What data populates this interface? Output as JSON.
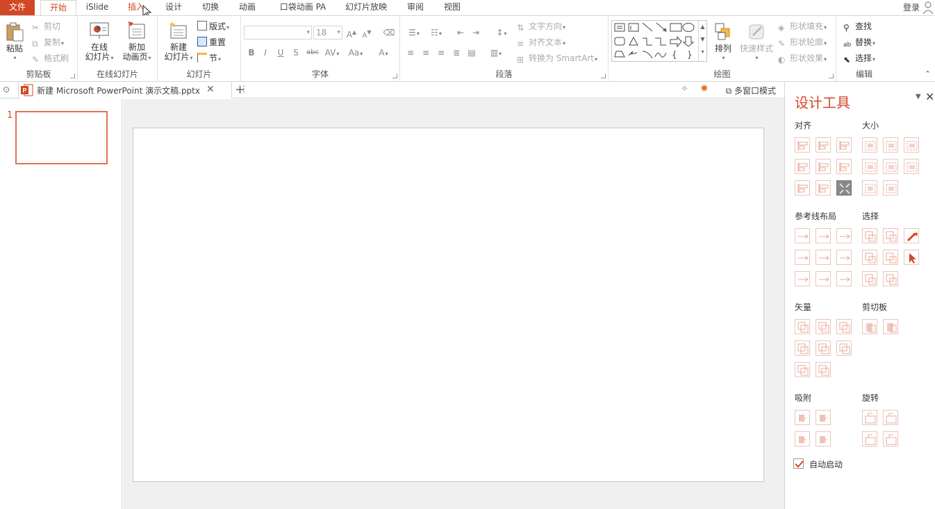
{
  "ribbon_tabs": {
    "file": "文件",
    "home": "开始",
    "islide": "iSlide",
    "insert": "插入",
    "design": "设计",
    "transition": "切换",
    "animation": "动画",
    "pocket": "口袋动画 PA",
    "slideshow": "幻灯片放映",
    "review": "审阅",
    "view": "视图",
    "login": "登录"
  },
  "clipboard": {
    "paste": "粘贴",
    "cut": "剪切",
    "copy": "复制",
    "painter": "格式刷",
    "label": "剪贴板"
  },
  "online_slides": {
    "online_l1": "在线",
    "online_l2": "幻灯片",
    "addanim_l1": "新加",
    "addanim_l2": "动画页",
    "label": "在线幻灯片"
  },
  "slides": {
    "new_l1": "新建",
    "new_l2": "幻灯片",
    "layout": "版式",
    "reset": "重置",
    "section": "节",
    "label": "幻灯片"
  },
  "font": {
    "size": "18",
    "label": "字体",
    "bold": "B",
    "italic": "I",
    "underline": "U",
    "shadow": "S",
    "strike": "abc",
    "spacing": "AV",
    "case": "Aa",
    "color": "A",
    "grow": "A",
    "shrink": "A"
  },
  "paragraph": {
    "text_direction": "文字方向",
    "align_text": "对齐文本",
    "smartart": "转换为 SmartArt",
    "label": "段落"
  },
  "drawing": {
    "arrange": "排列",
    "quick_styles": "快速样式",
    "fill": "形状填充",
    "outline": "形状轮廓",
    "effects": "形状效果",
    "label": "绘图"
  },
  "editing": {
    "find": "查找",
    "replace": "替换",
    "select": "选择",
    "label": "编辑"
  },
  "document": {
    "tab_name": "新建 Microsoft PowerPoint 演示文稿.pptx",
    "multi_window": "多窗口模式"
  },
  "thumbs": {
    "slide_number": "1"
  },
  "design_pane": {
    "title": "设计工具",
    "align": "对齐",
    "size": "大小",
    "guide_layout": "参考线布局",
    "select": "选择",
    "vector": "矢量",
    "clipboard": "剪切板",
    "snap": "吸附",
    "rotate": "旋转",
    "auto_start": "自动启动"
  },
  "colors": {
    "accent": "#d24726",
    "icon_light": "#e8a898"
  }
}
